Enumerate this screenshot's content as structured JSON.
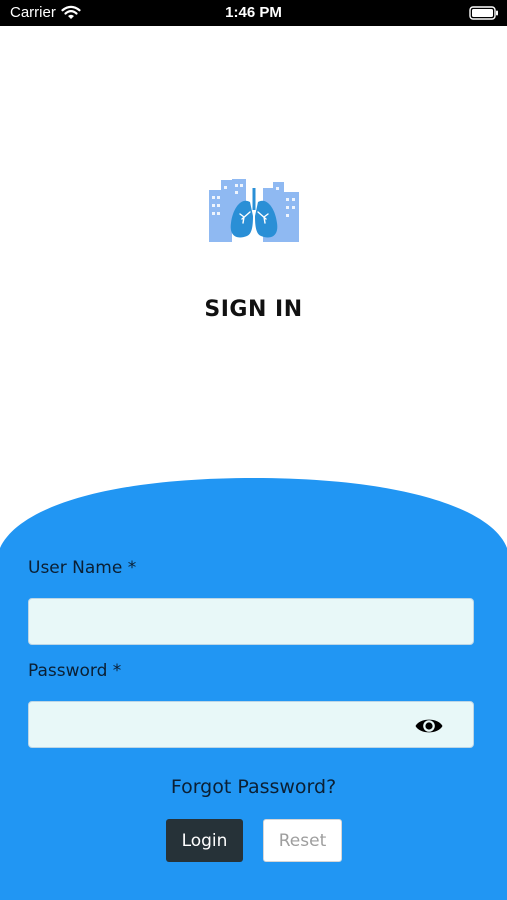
{
  "status_bar": {
    "carrier": "Carrier",
    "time": "1:46 PM",
    "wifi_icon": "wifi-icon",
    "battery_icon": "battery-icon"
  },
  "logo": {
    "icon": "lungs-city-logo",
    "colors": {
      "buildings": "#8fb9f2",
      "lungs": "#2a8fd6",
      "bronchi": "#ffffff"
    }
  },
  "title": "SIGN IN",
  "form": {
    "username_label": "User Name *",
    "username_value": "",
    "password_label": "Password *",
    "password_value": "",
    "password_toggle_icon": "eye-icon",
    "forgot_password": "Forgot Password?",
    "login_button": "Login",
    "reset_button": "Reset"
  },
  "colors": {
    "panel": "#2196f3",
    "input_bg": "#e8f8f8",
    "login_bg": "#263238",
    "reset_bg": "#ffffff",
    "reset_text": "#9e9e9e"
  }
}
